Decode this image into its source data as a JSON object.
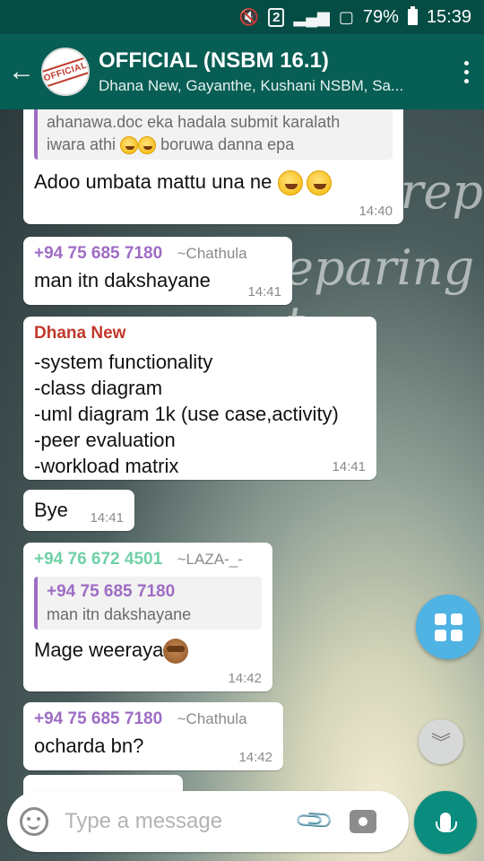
{
  "status_bar": {
    "signal_badge": "2",
    "battery": "79%",
    "time": "15:39"
  },
  "header": {
    "title": "OFFICIAL (NSBM 16.1)",
    "subtitle": "Dhana New, Gayanthe, Kushani NSBM, Sa...",
    "avatar_text": "OFFICIAL"
  },
  "background": {
    "script_line1": "prepa",
    "script_line2": "eparing t"
  },
  "messages": [
    {
      "quote_line1": "ahanawa.doc eka hadala submit karalath",
      "quote_line2": "iwara athi",
      "quote_line2_tail": "boruwa danna epa",
      "text": "Adoo umbata mattu una ne",
      "time": "14:40"
    },
    {
      "sender_number": "+94 75 685 7180",
      "sender_name": "~Chathula",
      "text": "man itn dakshayane",
      "time": "14:41"
    },
    {
      "sender": "Dhana New",
      "lines": [
        "-system functionality",
        "-class diagram",
        "-uml diagram 1k (use case,activity)",
        "-peer evaluation",
        "-workload matrix"
      ],
      "time": "14:41"
    },
    {
      "text": "Bye",
      "time": "14:41"
    },
    {
      "sender_number": "+94 76 672 4501",
      "sender_name": "~LAZA-_-",
      "quote_sender": "+94 75 685 7180",
      "quote_text": "man itn dakshayane",
      "text": "Mage weeraya",
      "time": "14:42"
    },
    {
      "sender_number": "+94 75 685 7180",
      "sender_name": "~Chathula",
      "text": "ocharda bn?",
      "time": "14:42"
    }
  ],
  "input": {
    "placeholder": "Type a message"
  },
  "icons": {
    "back": "arrow-left-icon",
    "menu": "more-vert-icon",
    "apps": "grid-icon",
    "scroll_down": "chevron-down-icon",
    "emoji": "smiley-icon",
    "attach": "paperclip-icon",
    "camera": "camera-icon",
    "mic": "mic-icon"
  },
  "colors": {
    "header": "#075e54",
    "status_bar": "#054d44",
    "mic": "#0a8d7e",
    "fab": "#4fb3e4",
    "sender_purple": "#9e6cc4",
    "sender_green": "#6fd1a7",
    "sender_red": "#c0392b"
  }
}
